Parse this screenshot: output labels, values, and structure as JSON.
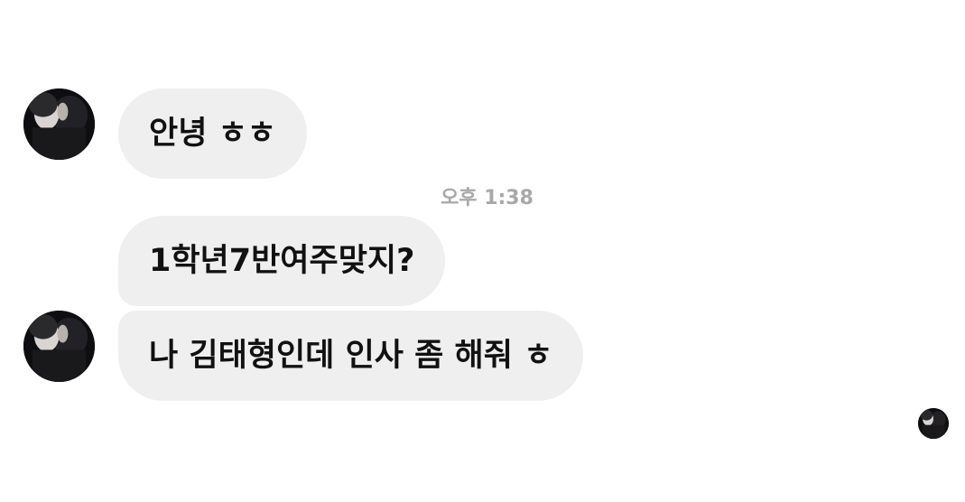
{
  "conversation": {
    "messages": [
      {
        "text": "안녕 ㅎㅎ"
      },
      {
        "text": "1학년7반여주맞지?"
      },
      {
        "text": "나 김태형인데 인사 좀 해줘 ㅎ"
      }
    ],
    "timestamp": "오후 1:38"
  }
}
